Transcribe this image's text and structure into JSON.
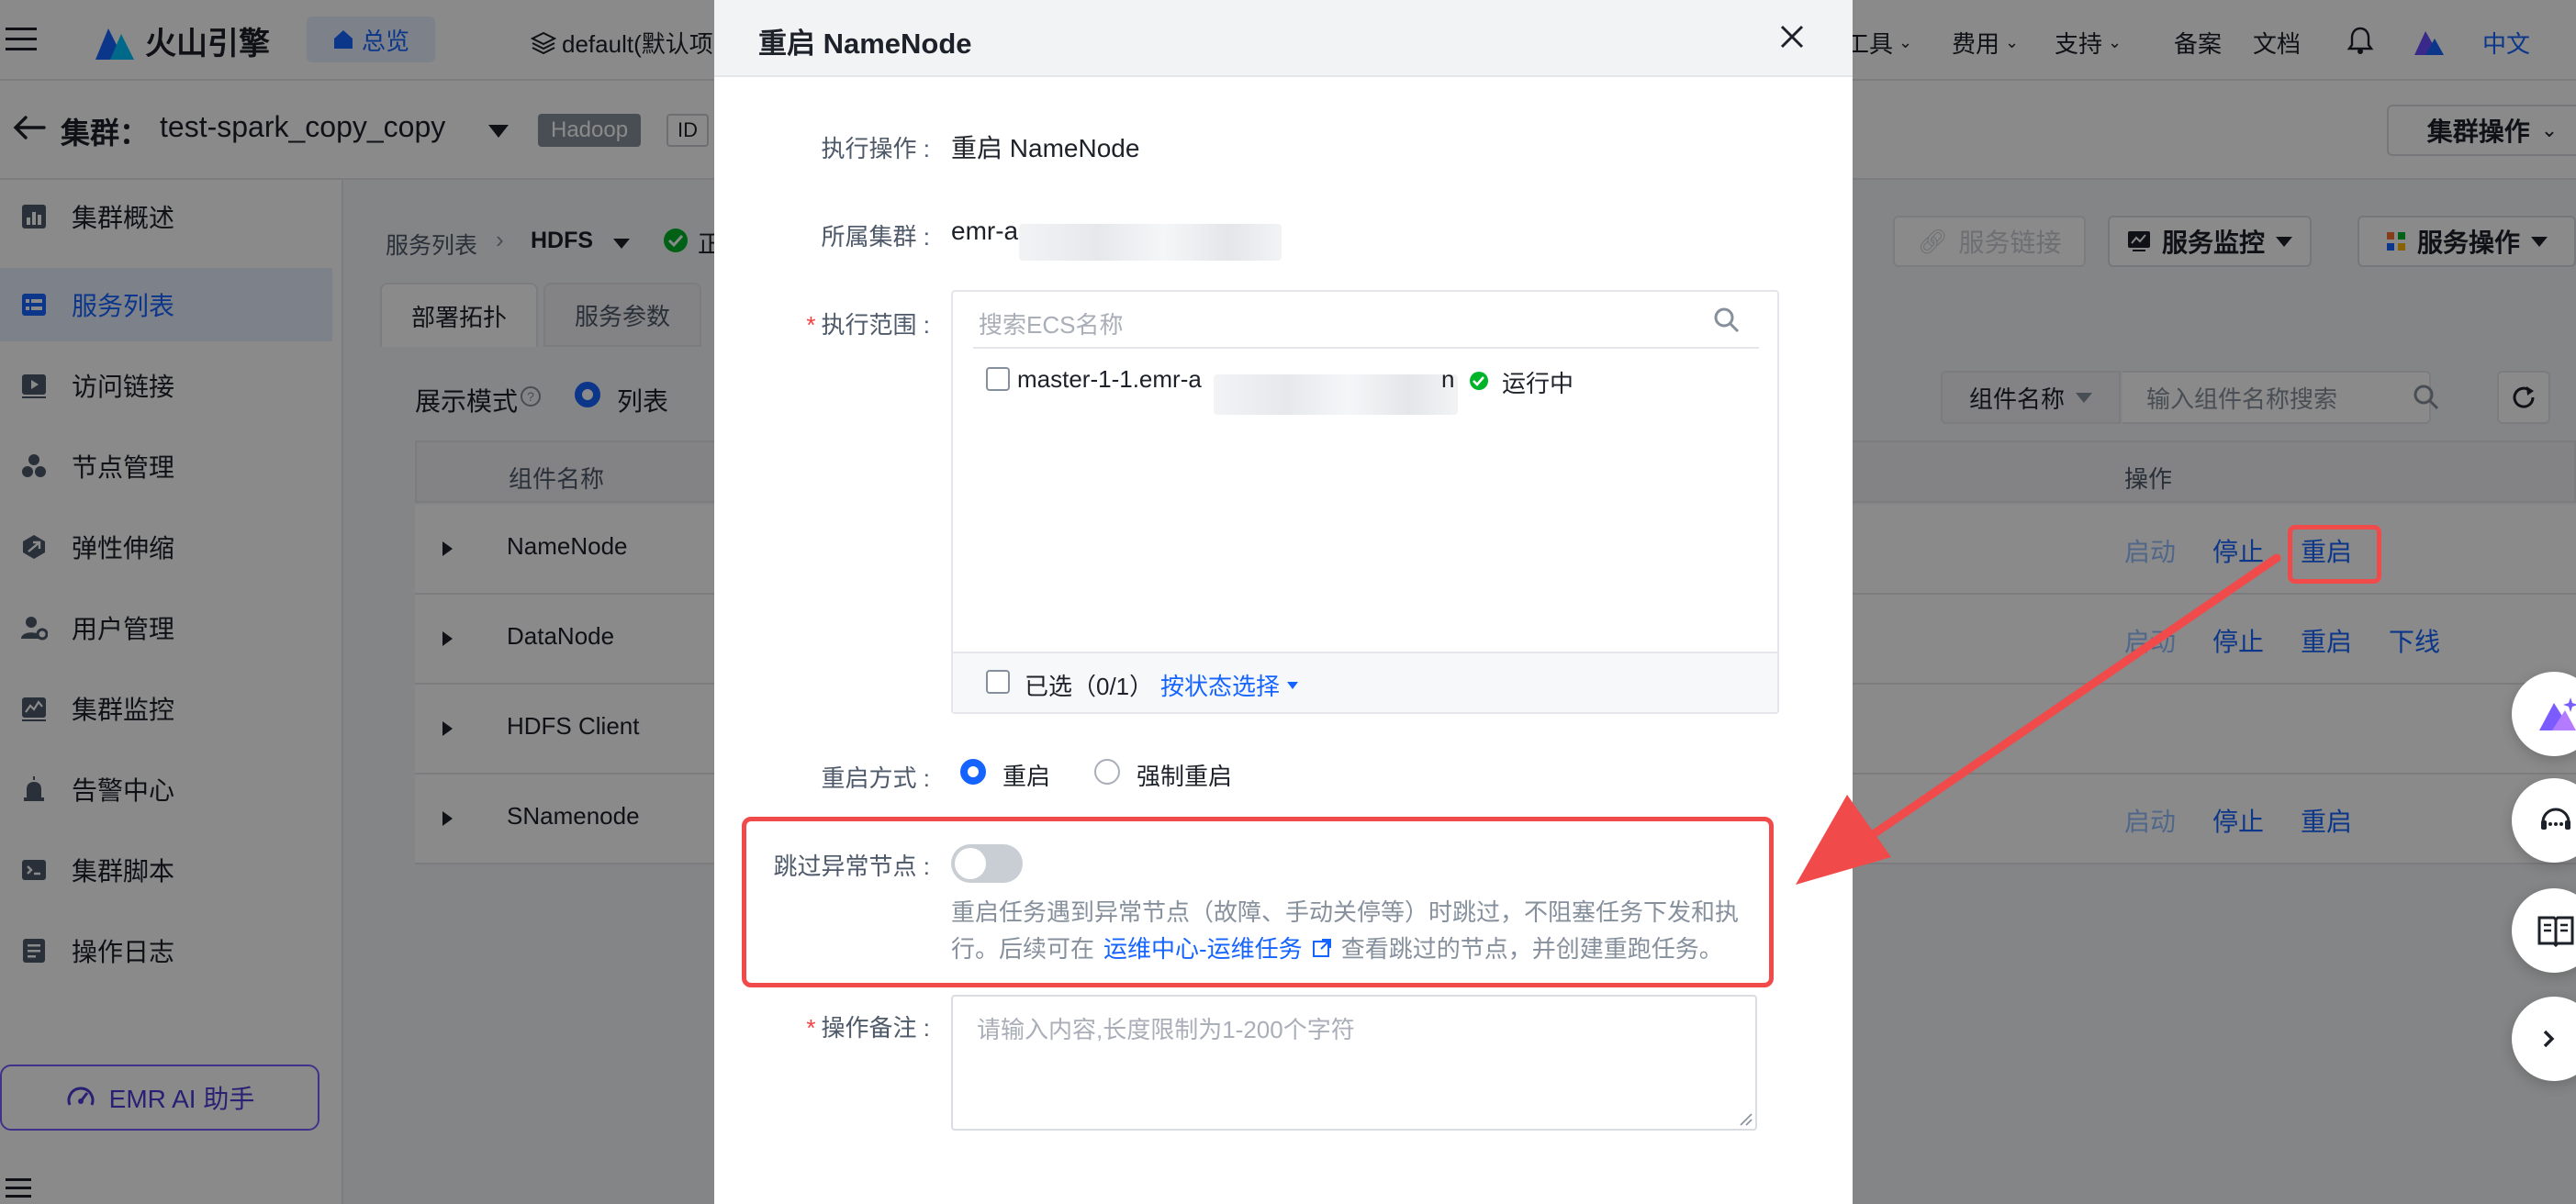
{
  "topbar": {
    "brand": "火山引擎",
    "overview_label": "总览",
    "project_label": "default(默认项",
    "nav": [
      {
        "label": "工具"
      },
      {
        "label": "费用"
      },
      {
        "label": "支持"
      },
      {
        "label": "备案"
      },
      {
        "label": "文档"
      }
    ],
    "language": "中文"
  },
  "cluster": {
    "prefix": "集群：",
    "name": "test-spark_copy_copy",
    "type_badge": "Hadoop",
    "id_label": "ID",
    "ops_button": "集群操作"
  },
  "sidebar": {
    "items": [
      {
        "label": "集群概述"
      },
      {
        "label": "服务列表"
      },
      {
        "label": "访问链接"
      },
      {
        "label": "节点管理"
      },
      {
        "label": "弹性伸缩"
      },
      {
        "label": "用户管理"
      },
      {
        "label": "集群监控"
      },
      {
        "label": "告警中心"
      },
      {
        "label": "集群脚本"
      },
      {
        "label": "操作日志"
      }
    ],
    "ai_button": "EMR AI 助手"
  },
  "service": {
    "breadcrumb_root": "服务列表",
    "breadcrumb_current": "HDFS",
    "status_partial": "正",
    "link_button": "服务链接",
    "monitor_button": "服务监控",
    "ops_button": "服务操作",
    "tabs": [
      {
        "label": "部署拓扑"
      },
      {
        "label": "服务参数"
      }
    ],
    "display_mode_label": "展示模式",
    "display_mode_value": "列表",
    "filter_select": "组件名称",
    "filter_placeholder": "输入组件名称搜索"
  },
  "table": {
    "headers": {
      "name": "组件名称",
      "ops": "操作"
    },
    "rows": [
      {
        "name": "NameNode",
        "ops": [
          "启动",
          "停止",
          "重启"
        ]
      },
      {
        "name": "DataNode",
        "ops": [
          "启动",
          "停止",
          "重启",
          "下线"
        ]
      },
      {
        "name": "HDFS Client",
        "ops": []
      },
      {
        "name": "SNamenode",
        "ops": [
          "启动",
          "停止",
          "重启"
        ]
      }
    ]
  },
  "modal": {
    "title": "重启 NameNode",
    "operation_label": "执行操作 :",
    "operation_value": "重启 NameNode",
    "cluster_label": "所属集群 :",
    "cluster_value": "emr-a",
    "scope_label": "执行范围 :",
    "search_placeholder": "搜索ECS名称",
    "node_name": "master-1-1.emr-a",
    "node_name_tail": "n",
    "node_status": "运行中",
    "selected_text": "已选（0/1）",
    "select_by_status": "按状态选择",
    "restart_mode_label": "重启方式 :",
    "restart_options": [
      {
        "label": "重启",
        "checked": true
      },
      {
        "label": "强制重启",
        "checked": false
      }
    ],
    "skip_label": "跳过异常节点 :",
    "skip_enabled": false,
    "skip_desc_1": "重启任务遇到异常节点（故障、手动关停等）时跳过，不阻塞任务下发和执",
    "skip_desc_2a": "行。后续可在",
    "skip_desc_link": "运维中心-运维任务",
    "skip_desc_2b": "查看跳过的节点，并创建重跑任务。",
    "remark_label": "操作备注 :",
    "remark_placeholder": "请输入内容,长度限制为1-200个字符"
  },
  "colors": {
    "primary": "#1664ff",
    "annotation": "#f04a4a",
    "success": "#00b42a",
    "mask": "rgba(0,0,0,0.46)"
  }
}
